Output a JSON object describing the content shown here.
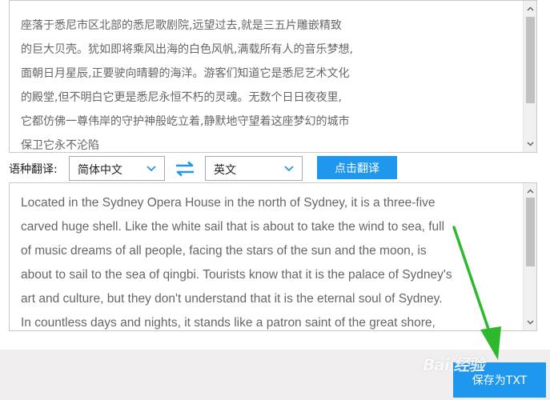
{
  "source_text": {
    "lines": [
      "座落于悉尼市区北部的悉尼歌剧院,远望过去,就是三五片雕嵌精致",
      "的巨大贝壳。犹如即将乘风出海的白色风帆,满载所有人的音乐梦想,",
      "面朝日月星辰,正要驶向晴碧的海洋。游客们知道它是悉尼艺术文化",
      "的殿堂,但不明白它更是悉尼永恒不朽的灵魂。无数个日日夜夜里,",
      "它都仿佛一尊伟岸的守护神般屹立着,静默地守望着这座梦幻的城市",
      "保卫它永不沦陷"
    ]
  },
  "language_bar": {
    "label": "语种翻译:",
    "source_language": "简体中文",
    "target_language": "英文",
    "swap_icon": "swap-arrows-icon",
    "translate_button": "点击翻译"
  },
  "result_text": {
    "lines": [
      "Located in the Sydney Opera House in the north of Sydney, it is a three-five",
      "carved huge shell. Like the white sail that is about to take the wind to sea, full",
      "of music dreams of all people, facing the stars of the sun and the moon, is",
      "about to sail to the sea of qingbi. Tourists know that it is the palace of Sydney's",
      "art and culture, but they don't understand that it is the eternal soul of Sydney.",
      "In countless days and nights, it stands like a patron saint of the great shore,"
    ]
  },
  "footer": {
    "save_button": "保存为TXT",
    "watermark": "Bai 经验"
  },
  "colors": {
    "accent": "#1e97ef",
    "text": "#666666",
    "border": "#c9c9c9",
    "footer_bg": "#f0eeee",
    "annotation_arrow": "#2db82d"
  },
  "icons": {
    "scroll_up": "chevron-up-icon",
    "scroll_down": "chevron-down-icon",
    "select_dropdown": "chevron-down-icon"
  }
}
